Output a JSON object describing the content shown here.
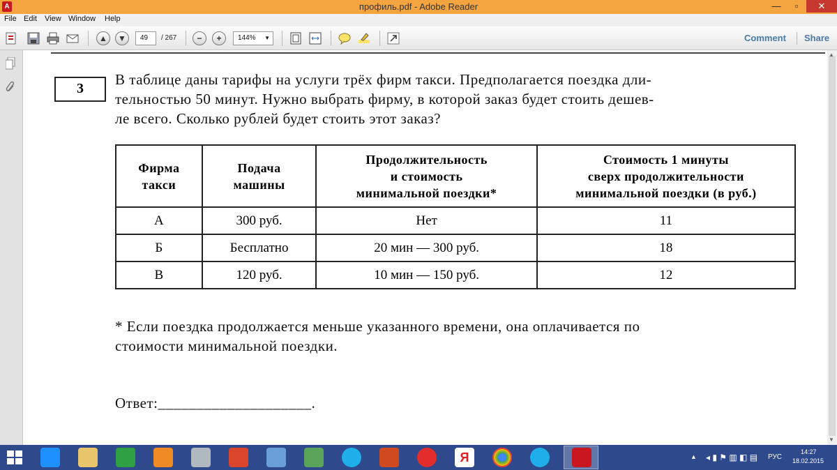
{
  "window": {
    "title": "профиль.pdf - Adobe Reader"
  },
  "menu": [
    "File",
    "Edit",
    "View",
    "Window",
    "Help"
  ],
  "toolbar": {
    "page_current": "49",
    "page_total": "/ 267",
    "zoom": "144%",
    "comment_label": "Comment",
    "share_label": "Share"
  },
  "document": {
    "task_number": "3",
    "question_lines": [
      "В таблице даны тарифы на услуги трёх фирм такси. Предполагается поездка дли-",
      "тельностью 50 минут. Нужно выбрать фирму, в которой заказ будет стоить дешев-",
      "ле всего. Сколько рублей будет стоить этот заказ?"
    ],
    "table": {
      "headers": [
        [
          "Фирма",
          "такси"
        ],
        [
          "Подача",
          "машины"
        ],
        [
          "Продолжительность",
          "и стоимость",
          "минимальной поездки*"
        ],
        [
          "Стоимость 1 минуты",
          "сверх продолжительности",
          "минимальной поездки (в руб.)"
        ]
      ],
      "rows": [
        [
          "А",
          "300 руб.",
          "Нет",
          "11"
        ],
        [
          "Б",
          "Бесплатно",
          "20 мин — 300 руб.",
          "18"
        ],
        [
          "В",
          "120 руб.",
          "10 мин — 150 руб.",
          "12"
        ]
      ]
    },
    "footnote_lines": [
      "* Если поездка продолжается меньше указанного времени, она оплачивается по",
      "стоимости минимальной поездки."
    ],
    "answer_label": "Ответ:",
    "answer_blank": "____________________."
  },
  "taskbar": {
    "lang": "РУС",
    "time": "14:27",
    "date": "18.02.2015"
  },
  "colors": {
    "titlebar": "#f4a540",
    "taskbar": "#2e4a8c",
    "link": "#4a7aa6"
  }
}
